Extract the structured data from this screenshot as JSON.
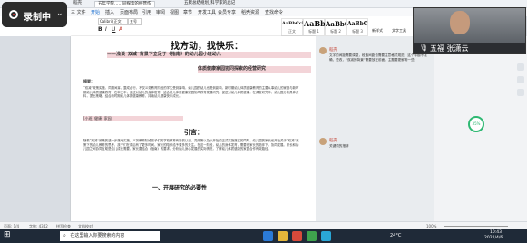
{
  "titlebar": {
    "tabs": [
      "稻壳",
      "五年学院……同探索的经营作",
      "五聚总结规划_科学家的启记"
    ],
    "right": "登录"
  },
  "menubar": {
    "items": [
      "三 文件",
      "开始",
      "插入",
      "页面布局",
      "引用",
      "审阅",
      "视图",
      "章节",
      "开发工具",
      "会员专享",
      "稻壳资源",
      "查找命令"
    ]
  },
  "ribbon": {
    "font_name": "Calibri (正文)",
    "font_size": "五号",
    "styles": [
      {
        "sample": "AaBbCcDd",
        "name": "正文"
      },
      {
        "sample": "AaBb",
        "name": "标题 1"
      },
      {
        "sample": "AaBbC",
        "name": "标题 2"
      },
      {
        "sample": "AaBbC",
        "name": "标题 3"
      }
    ],
    "new_style": "新样式",
    "text_tools": "文字工具"
  },
  "recording": {
    "label": "录制中"
  },
  "video_call": {
    "name": "五福 张潇云"
  },
  "document": {
    "headline": "找方动，找快乐：",
    "subtitle_line1": "——浅谈“双减”背景下立足于《指南》的幼儿园小班幼儿",
    "subtitle_line2": "体质健康家园协同探索的经营研究",
    "abstract_label": "摘要：",
    "abstract_text": "“双减”政策实施，同期间耳，整成必行，不仅义务教育阶段的学生受到影响，幼儿园的幼儿也受到影响，新时期幼儿体质健康教育的主要从事幼儿的家庭与新时期幼儿体质健康教育，在本文中，通过对幼儿的身体发育，结合幼儿体质健康家园协同教育发展研究，促进对幼儿体质健康，在调查研究中，幼儿园分析具体资料，提出策略，结合新时期幼儿体质健康教育，持续幼儿健康快乐成长。",
    "keywords": "[小班; 健康; 家园]",
    "intro_heading": "引言：",
    "intro_text": "随着“双减”政策的进一步落地实施，义务教育阶段孩子们的学校教育有新的认识，党政策以及从开始的正式实施落实的同时，幼儿园的家长也开始关于“双减”政策下的幼儿教育的思考，孩子们在课后有了更多时间，家长的陪伴给予更多的关注。在这一阶段，幼儿的身体发育，需要在家长的陪伴下，协同发展。家长和幼儿园之间协同互助是幼儿成长需要，家长要结合《指南》的要求，分析幼儿身心发展的实际情况，了解幼儿体质健康的家园合作有效路径。",
    "section_heading": "一、开展研究的必要性"
  },
  "comments": [
    {
      "author": "稻壳",
      "text": "文字的间距需要调整，段落间距也需要注意格式规范，这个标题不准确，更改，“双减的背景”需要放在前面，主题要更鲜明一些。"
    },
    {
      "author": "稻壳",
      "text": "关键词的措辞"
    }
  ],
  "statusbar": {
    "page": "页面: 1/4",
    "words": "字数: 4342",
    "spell": "拼写检查",
    "text_check": "文档校对",
    "zoom": "100%"
  },
  "taskbar": {
    "search_placeholder": "在这里输入你要搜索的内容",
    "weather": "24°C",
    "time": "10:43",
    "date": "2022/4/6"
  },
  "progress_badge": "35%"
}
